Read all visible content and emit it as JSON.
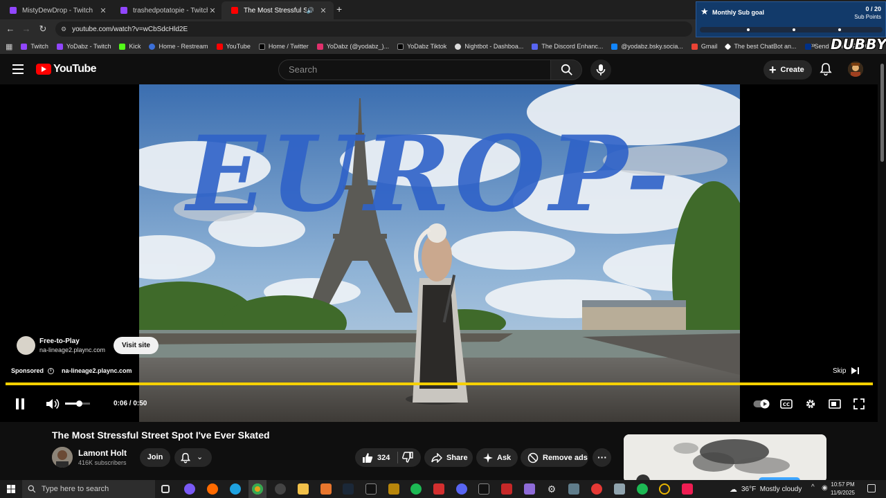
{
  "browser": {
    "tabs": [
      {
        "title": "MistyDewDrop - Twitch",
        "icon": "twitch-icon",
        "color": "#9146ff",
        "active": false
      },
      {
        "title": "trashedpotatopie - Twitch",
        "icon": "twitch-icon",
        "color": "#9146ff",
        "active": false
      },
      {
        "title": "The Most Stressful Street Sp",
        "icon": "youtube-icon",
        "color": "#ff0000",
        "active": true
      }
    ],
    "url": "youtube.com/watch?v=wCbSdcHld2E",
    "bookmarks": [
      {
        "label": "Twitch",
        "color": "#9146ff"
      },
      {
        "label": "YoDabz - Twitch",
        "color": "#9146ff"
      },
      {
        "label": "Kick",
        "color": "#53fc18"
      },
      {
        "label": "Home - Restream",
        "color": "#3b6fd8"
      },
      {
        "label": "YouTube",
        "color": "#ff0000"
      },
      {
        "label": "Home / Twitter",
        "color": "#000000"
      },
      {
        "label": "YoDabz (@yodabz_)...",
        "color": "#e1306c"
      },
      {
        "label": "YoDabz Tiktok",
        "color": "#000000"
      },
      {
        "label": "Nightbot - Dashboa...",
        "color": "#dddddd"
      },
      {
        "label": "The Discord Enhanc...",
        "color": "#5865f2"
      },
      {
        "label": "@yodabz.bsky.socia...",
        "color": "#1185fe"
      },
      {
        "label": "Gmail",
        "color": "#ea4335"
      },
      {
        "label": "The best ChatBot an...",
        "color": "#ffffff"
      },
      {
        "label": "Send Money, Pay O...",
        "color": "#003087"
      }
    ]
  },
  "overlay": {
    "goal_label": "Monthly Sub goal",
    "goal_count": "0 / 20",
    "goal_unit": "Sub Points",
    "brand": "DUBBY"
  },
  "youtube": {
    "logo_text": "YouTube",
    "search_placeholder": "Search",
    "create_label": "Create"
  },
  "player": {
    "ad_title": "Free-to-Play",
    "ad_domain": "na-lineage2.plaync.com",
    "visit_label": "Visit site",
    "sponsored_label": "Sponsored",
    "sponsored_domain": "na-lineage2.plaync.com",
    "skip_label": "Skip",
    "time": "0:06 / 0:50",
    "volume_level": 0.55,
    "video_overlay_text": "EUROP-"
  },
  "video": {
    "title": "The Most Stressful Street Spot I've Ever Skated",
    "channel": "Lamont Holt",
    "subscribers": "416K subscribers",
    "join_label": "Join",
    "likes": "324",
    "share_label": "Share",
    "ask_label": "Ask",
    "remove_ads_label": "Remove ads"
  },
  "taskbar": {
    "search_placeholder": "Type here to search",
    "weather": "36°F  Mostly cloudy",
    "time": "10:57 PM",
    "date": "11/9/2025"
  },
  "colors": {
    "ad_progress": "#f5d000",
    "youtube_red": "#ff0000",
    "page_bg": "#0f0f0f"
  }
}
